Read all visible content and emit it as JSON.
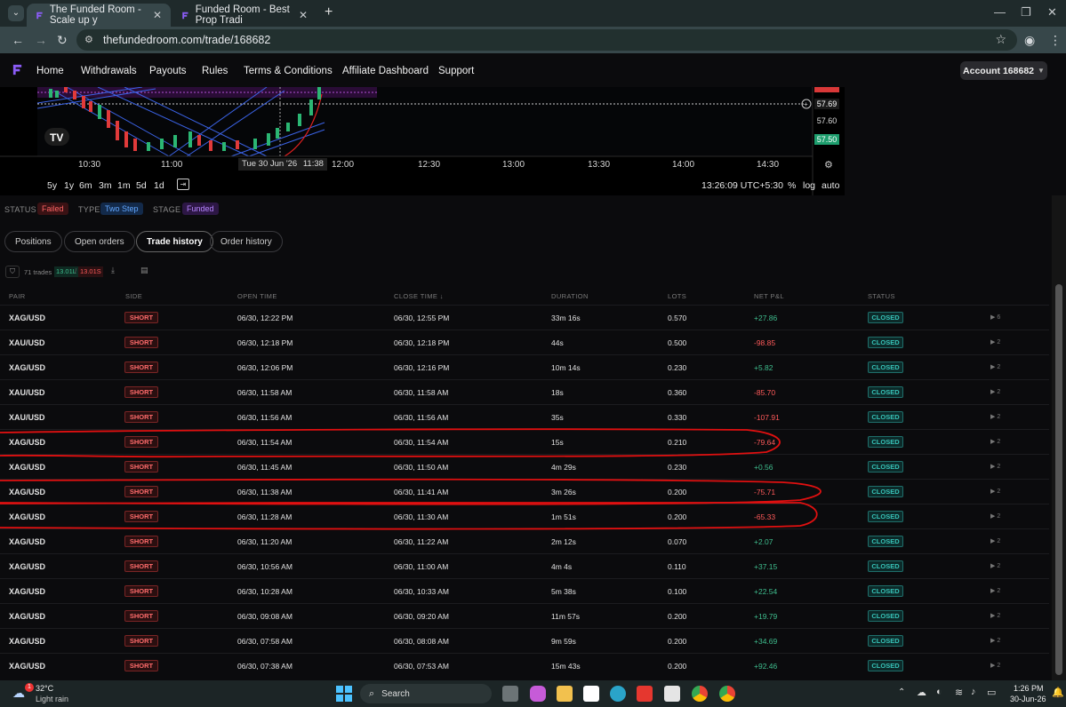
{
  "browser": {
    "tabs": [
      {
        "title": "The Funded Room - Scale up y",
        "active": true
      },
      {
        "title": "Funded Room - Best Prop Tradi",
        "active": false
      }
    ],
    "url": "thefundedroom.com/trade/168682"
  },
  "nav": {
    "items": [
      "Home",
      "Withdrawals",
      "Payouts",
      "Rules",
      "Terms & Conditions",
      "Affiliate Dashboard",
      "Support"
    ],
    "account": "Account 168682"
  },
  "chart": {
    "price_labels": [
      "57.69",
      "57.60",
      "57.50"
    ],
    "time_ticks": [
      "10:30",
      "11:00",
      "Tue 30 Jun '26",
      "11:38",
      "12:00",
      "12:30",
      "13:00",
      "13:30",
      "14:00",
      "14:30"
    ],
    "ranges": [
      "5y",
      "1y",
      "6m",
      "3m",
      "1m",
      "5d",
      "1d"
    ],
    "clock": "13:26:09 UTC+5:30",
    "options": [
      "%",
      "log",
      "auto"
    ]
  },
  "status": {
    "status_label": "STATUS",
    "status_value": "Failed",
    "type_label": "TYPE",
    "type_value": "Two Step",
    "stage_label": "STAGE",
    "stage_value": "Funded"
  },
  "tabs": [
    "Positions",
    "Open orders",
    "Trade history",
    "Order history"
  ],
  "toolbar": {
    "trades": "71 trades",
    "long": "13.01L",
    "short": "13.01S"
  },
  "table": {
    "headers": [
      "PAIR",
      "SIDE",
      "OPEN TIME",
      "CLOSE TIME ↓",
      "DURATION",
      "LOTS",
      "NET P&L",
      "STATUS"
    ],
    "rows": [
      {
        "pair": "XAG/USD",
        "side": "SHORT",
        "open": "06/30, 12:22 PM",
        "close": "06/30, 12:55 PM",
        "duration": "33m 16s",
        "lots": "0.570",
        "pnl": "+27.86",
        "status": "CLOSED",
        "n": "6"
      },
      {
        "pair": "XAU/USD",
        "side": "SHORT",
        "open": "06/30, 12:18 PM",
        "close": "06/30, 12:18 PM",
        "duration": "44s",
        "lots": "0.500",
        "pnl": "-98.85",
        "status": "CLOSED",
        "n": "2"
      },
      {
        "pair": "XAG/USD",
        "side": "SHORT",
        "open": "06/30, 12:06 PM",
        "close": "06/30, 12:16 PM",
        "duration": "10m 14s",
        "lots": "0.230",
        "pnl": "+5.82",
        "status": "CLOSED",
        "n": "2"
      },
      {
        "pair": "XAU/USD",
        "side": "SHORT",
        "open": "06/30, 11:58 AM",
        "close": "06/30, 11:58 AM",
        "duration": "18s",
        "lots": "0.360",
        "pnl": "-85.70",
        "status": "CLOSED",
        "n": "2"
      },
      {
        "pair": "XAU/USD",
        "side": "SHORT",
        "open": "06/30, 11:56 AM",
        "close": "06/30, 11:56 AM",
        "duration": "35s",
        "lots": "0.330",
        "pnl": "-107.91",
        "status": "CLOSED",
        "n": "2"
      },
      {
        "pair": "XAG/USD",
        "side": "SHORT",
        "open": "06/30, 11:54 AM",
        "close": "06/30, 11:54 AM",
        "duration": "15s",
        "lots": "0.210",
        "pnl": "-79.64",
        "status": "CLOSED",
        "n": "2"
      },
      {
        "pair": "XAG/USD",
        "side": "SHORT",
        "open": "06/30, 11:45 AM",
        "close": "06/30, 11:50 AM",
        "duration": "4m 29s",
        "lots": "0.230",
        "pnl": "+0.56",
        "status": "CLOSED",
        "n": "2"
      },
      {
        "pair": "XAG/USD",
        "side": "SHORT",
        "open": "06/30, 11:38 AM",
        "close": "06/30, 11:41 AM",
        "duration": "3m 26s",
        "lots": "0.200",
        "pnl": "-75.71",
        "status": "CLOSED",
        "n": "2"
      },
      {
        "pair": "XAG/USD",
        "side": "SHORT",
        "open": "06/30, 11:28 AM",
        "close": "06/30, 11:30 AM",
        "duration": "1m 51s",
        "lots": "0.200",
        "pnl": "-65.33",
        "status": "CLOSED",
        "n": "2"
      },
      {
        "pair": "XAG/USD",
        "side": "SHORT",
        "open": "06/30, 11:20 AM",
        "close": "06/30, 11:22 AM",
        "duration": "2m 12s",
        "lots": "0.070",
        "pnl": "+2.07",
        "status": "CLOSED",
        "n": "2"
      },
      {
        "pair": "XAG/USD",
        "side": "SHORT",
        "open": "06/30, 10:56 AM",
        "close": "06/30, 11:00 AM",
        "duration": "4m 4s",
        "lots": "0.110",
        "pnl": "+37.15",
        "status": "CLOSED",
        "n": "2"
      },
      {
        "pair": "XAG/USD",
        "side": "SHORT",
        "open": "06/30, 10:28 AM",
        "close": "06/30, 10:33 AM",
        "duration": "5m 38s",
        "lots": "0.100",
        "pnl": "+22.54",
        "status": "CLOSED",
        "n": "2"
      },
      {
        "pair": "XAG/USD",
        "side": "SHORT",
        "open": "06/30, 09:08 AM",
        "close": "06/30, 09:20 AM",
        "duration": "11m 57s",
        "lots": "0.200",
        "pnl": "+19.79",
        "status": "CLOSED",
        "n": "2"
      },
      {
        "pair": "XAG/USD",
        "side": "SHORT",
        "open": "06/30, 07:58 AM",
        "close": "06/30, 08:08 AM",
        "duration": "9m 59s",
        "lots": "0.200",
        "pnl": "+34.69",
        "status": "CLOSED",
        "n": "2"
      },
      {
        "pair": "XAG/USD",
        "side": "SHORT",
        "open": "06/30, 07:38 AM",
        "close": "06/30, 07:53 AM",
        "duration": "15m 43s",
        "lots": "0.200",
        "pnl": "+92.46",
        "status": "CLOSED",
        "n": "2"
      }
    ]
  },
  "colors": {
    "positive": "#3fbf8f",
    "negative": "#ff5a5a",
    "annotation": "#e01010"
  },
  "taskbar": {
    "weather_temp": "32°C",
    "weather_desc": "Light rain",
    "weather_badge": "1",
    "search": "Search",
    "time": "1:26 PM",
    "date": "30-Jun-26"
  }
}
